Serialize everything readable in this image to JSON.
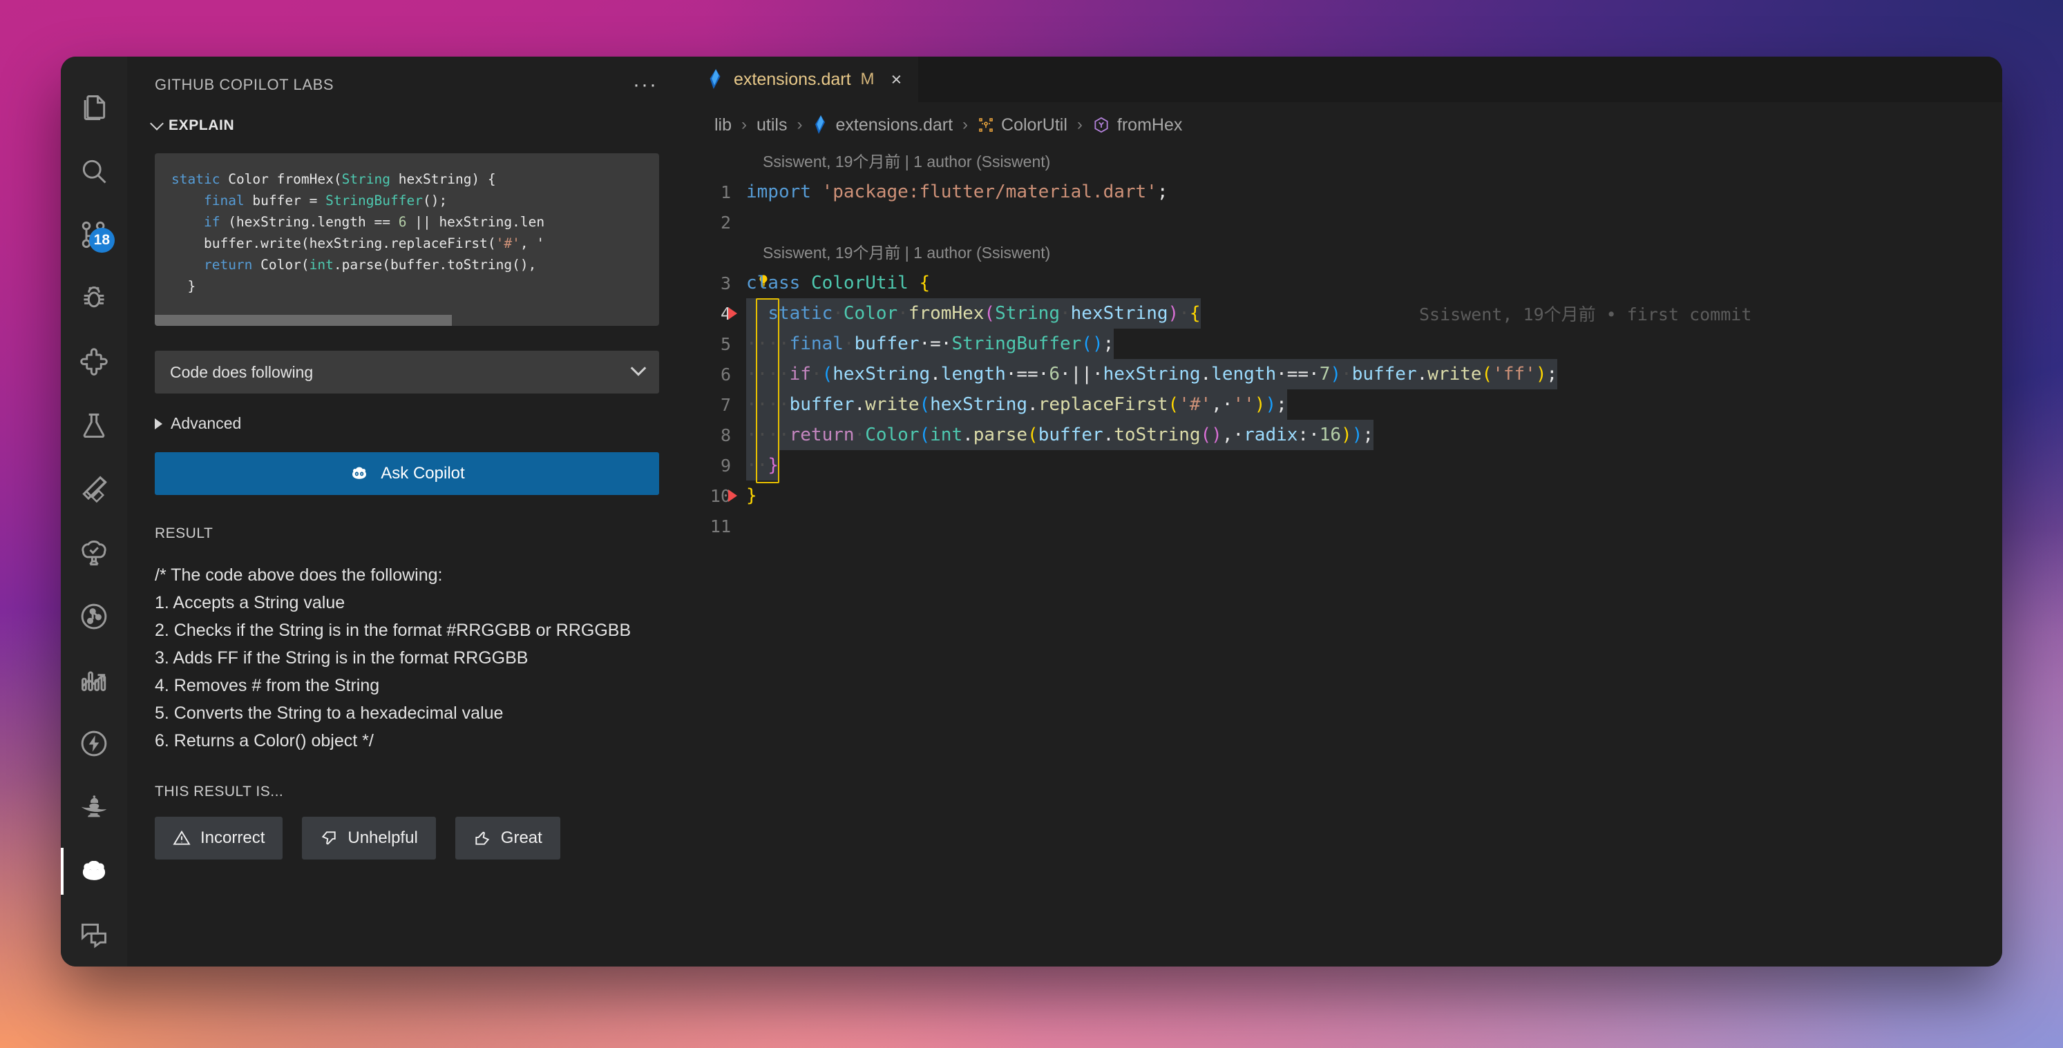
{
  "activitybar": {
    "items": [
      {
        "name": "explorer",
        "icon": "files-icon"
      },
      {
        "name": "search",
        "icon": "search-icon"
      },
      {
        "name": "source-control",
        "icon": "source-control-icon",
        "badge": "18"
      },
      {
        "name": "run-and-debug",
        "icon": "debug-icon"
      },
      {
        "name": "extensions",
        "icon": "extensions-icon"
      },
      {
        "name": "testing",
        "icon": "beaker-icon"
      },
      {
        "name": "flutter",
        "icon": "flutter-icon"
      },
      {
        "name": "test-explorer",
        "icon": "tree-check-icon"
      },
      {
        "name": "dependency-graph",
        "icon": "graph-circle-icon"
      },
      {
        "name": "metrics",
        "icon": "chart-arrow-icon"
      },
      {
        "name": "performance",
        "icon": "lightning-circle-icon"
      },
      {
        "name": "genie",
        "icon": "lamp-icon"
      },
      {
        "name": "copilot-labs",
        "icon": "copilot-icon",
        "active": true
      },
      {
        "name": "comments",
        "icon": "comments-icon"
      }
    ]
  },
  "panel": {
    "title": "GITHUB COPILOT LABS",
    "more_label": "···",
    "section": {
      "label": "EXPLAIN",
      "expanded": true
    },
    "snippet": [
      {
        "indent": 0,
        "tokens": [
          {
            "t": "static",
            "c": "k2"
          },
          {
            "t": " ",
            "c": "pl"
          },
          {
            "t": "Color",
            "c": "pl"
          },
          {
            "t": " fromHex(",
            "c": "pl"
          },
          {
            "t": "String",
            "c": "ty"
          },
          {
            "t": " hexString) {",
            "c": "pl"
          }
        ]
      },
      {
        "indent": 1,
        "tokens": [
          {
            "t": "final",
            "c": "k2"
          },
          {
            "t": " buffer = ",
            "c": "pl"
          },
          {
            "t": "StringBuffer",
            "c": "ty"
          },
          {
            "t": "();",
            "c": "pl"
          }
        ]
      },
      {
        "indent": 1,
        "tokens": [
          {
            "t": "if",
            "c": "k2"
          },
          {
            "t": " (hexString.length == ",
            "c": "pl"
          },
          {
            "t": "6",
            "c": "nu"
          },
          {
            "t": " || hexString.len",
            "c": "pl"
          }
        ]
      },
      {
        "indent": 1,
        "tokens": [
          {
            "t": "buffer.write(hexString.replaceFirst(",
            "c": "pl"
          },
          {
            "t": "'#'",
            "c": "st"
          },
          {
            "t": ", '",
            "c": "pl"
          }
        ]
      },
      {
        "indent": 1,
        "tokens": [
          {
            "t": "return",
            "c": "k2"
          },
          {
            "t": " Color(",
            "c": "pl"
          },
          {
            "t": "int",
            "c": "ty"
          },
          {
            "t": ".parse(buffer.toString(),",
            "c": "pl"
          }
        ]
      },
      {
        "indent": 0,
        "tokens": [
          {
            "t": "  }",
            "c": "pl"
          }
        ]
      }
    ],
    "select": {
      "value": "Code does following"
    },
    "advanced": {
      "label": "Advanced",
      "expanded": false
    },
    "ask_button": {
      "label": "Ask Copilot",
      "icon": "copilot-icon"
    },
    "result_label": "RESULT",
    "result_lines": [
      "/* The code above does the following:",
      "1. Accepts a String value",
      "2. Checks if the String is in the format #RRGGBB or RRGGBB",
      "3. Adds FF if the String is in the format RRGGBB",
      "4. Removes # from the String",
      "5. Converts the String to a hexadecimal value",
      "6. Returns a Color() object */"
    ],
    "feedback_label": "THIS RESULT IS...",
    "feedback_buttons": [
      {
        "label": "Incorrect",
        "icon": "warning-triangle-icon"
      },
      {
        "label": "Unhelpful",
        "icon": "thumbs-down-icon"
      },
      {
        "label": "Great",
        "icon": "thumbs-up-icon"
      }
    ]
  },
  "editor": {
    "tab": {
      "label": "extensions.dart",
      "modified_marker": "M",
      "close": "×",
      "icon": "dart-icon"
    },
    "breadcrumb": [
      {
        "label": "lib",
        "icon": null
      },
      {
        "label": "utils",
        "icon": null
      },
      {
        "label": "extensions.dart",
        "icon": "dart-icon"
      },
      {
        "label": "ColorUtil",
        "icon": "class-symbol-icon"
      },
      {
        "label": "fromHex",
        "icon": "method-symbol-icon"
      }
    ],
    "breadcrumb_separator": "›",
    "blame_header_1": "Ssiswent, 19个月前 | 1 author (Ssiswent)",
    "blame_header_2": "Ssiswent, 19个月前 | 1 author (Ssiswent)",
    "inline_blame": "Ssiswent, 19个月前 • first commit",
    "lines": [
      {
        "n": "1",
        "tokens": [
          {
            "t": "import",
            "c": "k2"
          },
          {
            "t": " ",
            "c": "pl"
          },
          {
            "t": "'package:flutter/material.dart'",
            "c": "st"
          },
          {
            "t": ";",
            "c": "pl"
          }
        ]
      },
      {
        "n": "2",
        "tokens": []
      },
      {
        "n": "3",
        "tokens": [
          {
            "t": "class",
            "c": "k2"
          },
          {
            "t": " ",
            "c": "pl"
          },
          {
            "t": "ColorUtil",
            "c": "ty"
          },
          {
            "t": " ",
            "c": "pl"
          },
          {
            "t": "{",
            "c": "p1"
          }
        ],
        "lightbulb": true
      },
      {
        "n": "4",
        "tokens": [
          {
            "t": "  ",
            "c": "ws"
          },
          {
            "t": "static",
            "c": "k2"
          },
          {
            "t": "·",
            "c": "ws"
          },
          {
            "t": "Color",
            "c": "ty"
          },
          {
            "t": "·",
            "c": "ws"
          },
          {
            "t": "fromHex",
            "c": "fn"
          },
          {
            "t": "(",
            "c": "p2"
          },
          {
            "t": "String",
            "c": "ty"
          },
          {
            "t": "·",
            "c": "ws"
          },
          {
            "t": "hexString",
            "c": "va"
          },
          {
            "t": ")",
            "c": "p2"
          },
          {
            "t": "·",
            "c": "ws"
          },
          {
            "t": "{",
            "c": "p1"
          }
        ],
        "current": true,
        "changed": true
      },
      {
        "n": "5",
        "tokens": [
          {
            "t": "····",
            "c": "ws"
          },
          {
            "t": "final",
            "c": "k2"
          },
          {
            "t": "·",
            "c": "ws"
          },
          {
            "t": "buffer",
            "c": "va"
          },
          {
            "t": "·=·",
            "c": "pl"
          },
          {
            "t": "StringBuffer",
            "c": "ty"
          },
          {
            "t": "(",
            "c": "p3"
          },
          {
            "t": ")",
            "c": "p3"
          },
          {
            "t": ";",
            "c": "pl"
          }
        ]
      },
      {
        "n": "6",
        "tokens": [
          {
            "t": "····",
            "c": "ws"
          },
          {
            "t": "if",
            "c": "k"
          },
          {
            "t": "·",
            "c": "ws"
          },
          {
            "t": "(",
            "c": "p3"
          },
          {
            "t": "hexString",
            "c": "va"
          },
          {
            "t": ".",
            "c": "pl"
          },
          {
            "t": "length",
            "c": "va"
          },
          {
            "t": "·==·",
            "c": "pl"
          },
          {
            "t": "6",
            "c": "nu"
          },
          {
            "t": "·||·",
            "c": "pl"
          },
          {
            "t": "hexString",
            "c": "va"
          },
          {
            "t": ".",
            "c": "pl"
          },
          {
            "t": "length",
            "c": "va"
          },
          {
            "t": "·==·",
            "c": "pl"
          },
          {
            "t": "7",
            "c": "nu"
          },
          {
            "t": ")",
            "c": "p3"
          },
          {
            "t": "·",
            "c": "ws"
          },
          {
            "t": "buffer",
            "c": "va"
          },
          {
            "t": ".",
            "c": "pl"
          },
          {
            "t": "write",
            "c": "fn"
          },
          {
            "t": "(",
            "c": "p1"
          },
          {
            "t": "'ff'",
            "c": "st"
          },
          {
            "t": ")",
            "c": "p1"
          },
          {
            "t": ";",
            "c": "pl"
          }
        ]
      },
      {
        "n": "7",
        "tokens": [
          {
            "t": "····",
            "c": "ws"
          },
          {
            "t": "buffer",
            "c": "va"
          },
          {
            "t": ".",
            "c": "pl"
          },
          {
            "t": "write",
            "c": "fn"
          },
          {
            "t": "(",
            "c": "p3"
          },
          {
            "t": "hexString",
            "c": "va"
          },
          {
            "t": ".",
            "c": "pl"
          },
          {
            "t": "replaceFirst",
            "c": "fn"
          },
          {
            "t": "(",
            "c": "p1"
          },
          {
            "t": "'#'",
            "c": "st"
          },
          {
            "t": ",·",
            "c": "pl"
          },
          {
            "t": "''",
            "c": "st"
          },
          {
            "t": ")",
            "c": "p1"
          },
          {
            "t": ")",
            "c": "p3"
          },
          {
            "t": ";",
            "c": "pl"
          }
        ]
      },
      {
        "n": "8",
        "tokens": [
          {
            "t": "····",
            "c": "ws"
          },
          {
            "t": "return",
            "c": "k"
          },
          {
            "t": "·",
            "c": "ws"
          },
          {
            "t": "Color",
            "c": "ty"
          },
          {
            "t": "(",
            "c": "p3"
          },
          {
            "t": "int",
            "c": "ty"
          },
          {
            "t": ".",
            "c": "pl"
          },
          {
            "t": "parse",
            "c": "fn"
          },
          {
            "t": "(",
            "c": "p1"
          },
          {
            "t": "buffer",
            "c": "va"
          },
          {
            "t": ".",
            "c": "pl"
          },
          {
            "t": "toString",
            "c": "fn"
          },
          {
            "t": "()",
            "c": "p2"
          },
          {
            "t": ",·",
            "c": "pl"
          },
          {
            "t": "radix",
            "c": "va"
          },
          {
            "t": ":·",
            "c": "pl"
          },
          {
            "t": "16",
            "c": "nu"
          },
          {
            "t": ")",
            "c": "p1"
          },
          {
            "t": ")",
            "c": "p3"
          },
          {
            "t": ";",
            "c": "pl"
          }
        ]
      },
      {
        "n": "9",
        "tokens": [
          {
            "t": "··",
            "c": "ws"
          },
          {
            "t": "}",
            "c": "p2"
          }
        ]
      },
      {
        "n": "10",
        "tokens": [
          {
            "t": "}",
            "c": "p1"
          }
        ],
        "changed": true
      },
      {
        "n": "11",
        "tokens": []
      }
    ]
  }
}
